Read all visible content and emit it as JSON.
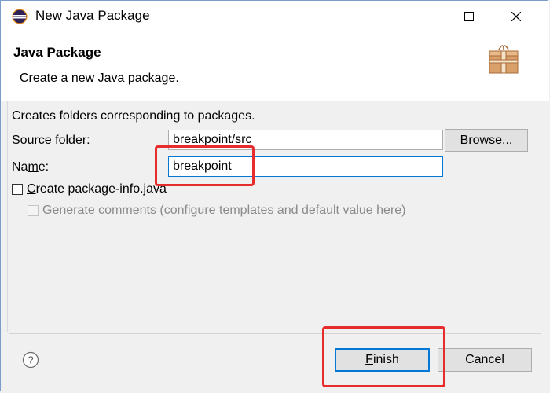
{
  "window": {
    "title": "New Java Package"
  },
  "banner": {
    "title": "Java Package",
    "description": "Create a new Java package.",
    "icon": "package-icon"
  },
  "form": {
    "intro": "Creates folders corresponding to packages.",
    "source_folder": {
      "label_pre": "Source fol",
      "label_mnemonic": "d",
      "label_post": "er:",
      "value": "breakpoint/src"
    },
    "name": {
      "label_pre": "Na",
      "label_mnemonic": "m",
      "label_post": "e:",
      "value": "breakpoint"
    },
    "browse_button": {
      "label_pre": "Br",
      "label_mnemonic": "o",
      "label_post": "wse..."
    },
    "create_package_info": {
      "label_mnemonic": "C",
      "label_post": "reate package-info.java",
      "checked": false
    },
    "generate_comments": {
      "label_mnemonic": "G",
      "label_mid": "enerate comments (configure templates and default value ",
      "label_link": "here",
      "label_end": ")",
      "checked": false,
      "enabled": false
    }
  },
  "footer": {
    "help_icon": "help-icon",
    "finish_mnemonic": "F",
    "finish_post": "inish",
    "cancel_label": "Cancel"
  },
  "colors": {
    "highlight": "#e62c2c",
    "focus": "#0078d7"
  }
}
